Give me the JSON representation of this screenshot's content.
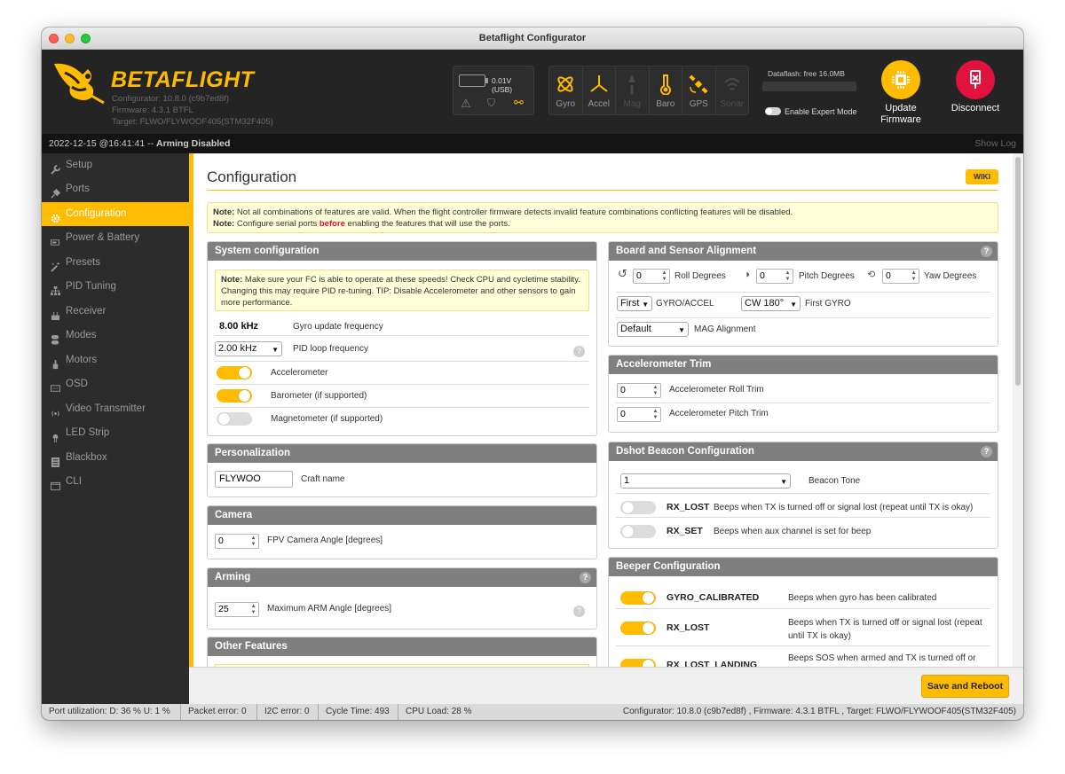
{
  "window": {
    "title": "Betaflight Configurator"
  },
  "header": {
    "brand": "BETAFLIGHT",
    "configurator_version": "Configurator: 10.8.0 (c9b7ed8f)",
    "firmware_version": "Firmware: 4.3.1 BTFL",
    "target": "Target: FLWO/FLYWOOF405(STM32F405)",
    "battery_voltage": "0.01V (USB)",
    "sensors": [
      {
        "label": "Gyro",
        "active": true
      },
      {
        "label": "Accel",
        "active": true
      },
      {
        "label": "Mag",
        "active": false
      },
      {
        "label": "Baro",
        "active": true
      },
      {
        "label": "GPS",
        "active": true
      },
      {
        "label": "Sonar",
        "active": false
      }
    ],
    "dataflash": "Dataflash: free 16.0MB",
    "expert_mode_label": "Enable Expert Mode",
    "update_firmware_label": "Update Firmware",
    "disconnect_label": "Disconnect"
  },
  "status": {
    "log_time": "2022-12-15 @16:41:41 --",
    "arming": "Arming Disabled",
    "show_log": "Show Log"
  },
  "sidebar": {
    "items": [
      {
        "label": "Setup",
        "icon": "wrench-icon"
      },
      {
        "label": "Ports",
        "icon": "plug-icon"
      },
      {
        "label": "Configuration",
        "icon": "gear-icon",
        "active": true
      },
      {
        "label": "Power & Battery",
        "icon": "battery-icon"
      },
      {
        "label": "Presets",
        "icon": "magic-wand-icon"
      },
      {
        "label": "PID Tuning",
        "icon": "sitemap-icon"
      },
      {
        "label": "Receiver",
        "icon": "receiver-icon"
      },
      {
        "label": "Modes",
        "icon": "switch-icon"
      },
      {
        "label": "Motors",
        "icon": "motor-icon"
      },
      {
        "label": "OSD",
        "icon": "osd-icon"
      },
      {
        "label": "Video Transmitter",
        "icon": "broadcast-icon"
      },
      {
        "label": "LED Strip",
        "icon": "led-icon"
      },
      {
        "label": "Blackbox",
        "icon": "blackbox-icon"
      },
      {
        "label": "CLI",
        "icon": "terminal-icon"
      }
    ]
  },
  "main": {
    "title": "Configuration",
    "wiki_label": "WIKI",
    "note1_label": "Note:",
    "note1_text": "Not all combinations of features are valid. When the flight controller firmware detects invalid feature combinations conflicting features will be disabled.",
    "note2_label": "Note:",
    "note2_pre": "Configure serial ports",
    "note2_bold": "before",
    "note2_post": "enabling the features that will use the ports.",
    "system": {
      "title": "System configuration",
      "note_label": "Note:",
      "note_text": "Make sure your FC is able to operate at these speeds! Check CPU and cycletime stability. Changing this may require PID re-tuning. TIP: Disable Accelerometer and other sensors to gain more performance.",
      "gyro_freq_value": "8.00 kHz",
      "gyro_freq_label": "Gyro update frequency",
      "pid_loop_value": "2.00 kHz",
      "pid_loop_label": "PID loop frequency",
      "accelerometer_label": "Accelerometer",
      "barometer_label": "Barometer (if supported)",
      "magnetometer_label": "Magnetometer (if supported)"
    },
    "personalization": {
      "title": "Personalization",
      "craft_name_value": "FLYWOO",
      "craft_name_label": "Craft name"
    },
    "camera": {
      "title": "Camera",
      "angle_value": "0",
      "angle_label": "FPV Camera Angle [degrees]"
    },
    "arming": {
      "title": "Arming",
      "angle_value": "25",
      "angle_label": "Maximum ARM Angle [degrees]"
    },
    "other": {
      "title": "Other Features"
    },
    "alignment": {
      "title": "Board and Sensor Alignment",
      "roll_value": "0",
      "roll_label": "Roll Degrees",
      "pitch_value": "0",
      "pitch_label": "Pitch Degrees",
      "yaw_value": "0",
      "yaw_label": "Yaw Degrees",
      "gyro_select": "First",
      "gyro_select_label": "GYRO/ACCEL",
      "gyro_align": "CW 180°",
      "gyro_align_label": "First GYRO",
      "mag_align": "Default",
      "mag_align_label": "MAG Alignment"
    },
    "acc_trim": {
      "title": "Accelerometer Trim",
      "roll_value": "0",
      "roll_label": "Accelerometer Roll Trim",
      "pitch_value": "0",
      "pitch_label": "Accelerometer Pitch Trim"
    },
    "dshot": {
      "title": "Dshot Beacon Configuration",
      "tone_value": "1",
      "tone_label": "Beacon Tone",
      "rx_lost_name": "RX_LOST",
      "rx_lost_desc": "Beeps when TX is turned off or signal lost (repeat until TX is okay)",
      "rx_set_name": "RX_SET",
      "rx_set_desc": "Beeps when aux channel is set for beep"
    },
    "beeper": {
      "title": "Beeper Configuration",
      "items": [
        {
          "name": "GYRO_CALIBRATED",
          "desc": "Beeps when gyro has been calibrated"
        },
        {
          "name": "RX_LOST",
          "desc": "Beeps when TX is turned off or signal lost (repeat until TX is okay)"
        },
        {
          "name": "RX_LOST_LANDING",
          "desc": "Beeps SOS when armed and TX is turned off or"
        }
      ]
    },
    "save_label": "Save and Reboot"
  },
  "bottom": {
    "port_util": "Port utilization: D: 36 % U: 1 %",
    "packet_error": "Packet error: 0",
    "i2c_error": "I2C error: 0",
    "cycle_time": "Cycle Time: 493",
    "cpu_load": "CPU Load: 28 %",
    "info": "Configurator: 10.8.0 (c9b7ed8f) , Firmware: 4.3.1 BTFL , Target: FLWO/FLYWOOF405(STM32F405)"
  },
  "colors": {
    "accent": "#ffbb00",
    "header_bg": "#242424",
    "sidebar_bg": "#2c2c2c",
    "disconnect": "#e2123f"
  }
}
